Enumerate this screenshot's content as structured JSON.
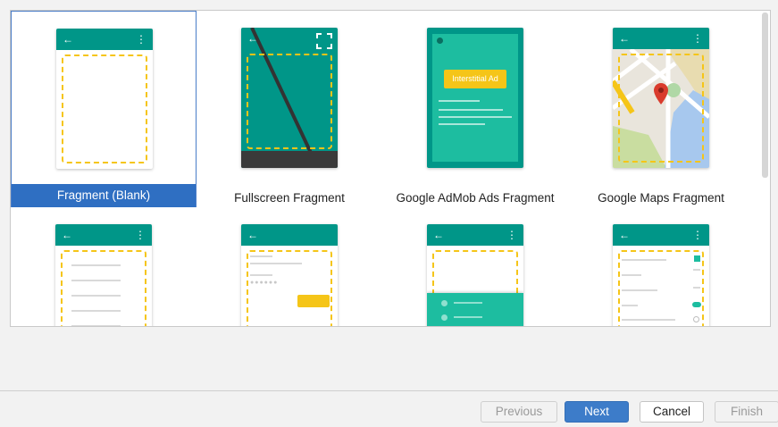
{
  "gallery": {
    "templates": [
      {
        "label": "Fragment (Blank)",
        "selected": true
      },
      {
        "label": "Fullscreen Fragment",
        "selected": false
      },
      {
        "label": "Google AdMob Ads Fragment",
        "selected": false,
        "ad_label": "Interstitial Ad"
      },
      {
        "label": "Google Maps Fragment",
        "selected": false
      }
    ]
  },
  "icons": {
    "back": "←",
    "overflow": "⋮"
  },
  "buttons": {
    "previous": "Previous",
    "next": "Next",
    "cancel": "Cancel",
    "finish": "Finish"
  },
  "colors": {
    "teal": "#009688",
    "accent_yellow": "#f5c518",
    "selection_blue": "#2f6fc2"
  }
}
